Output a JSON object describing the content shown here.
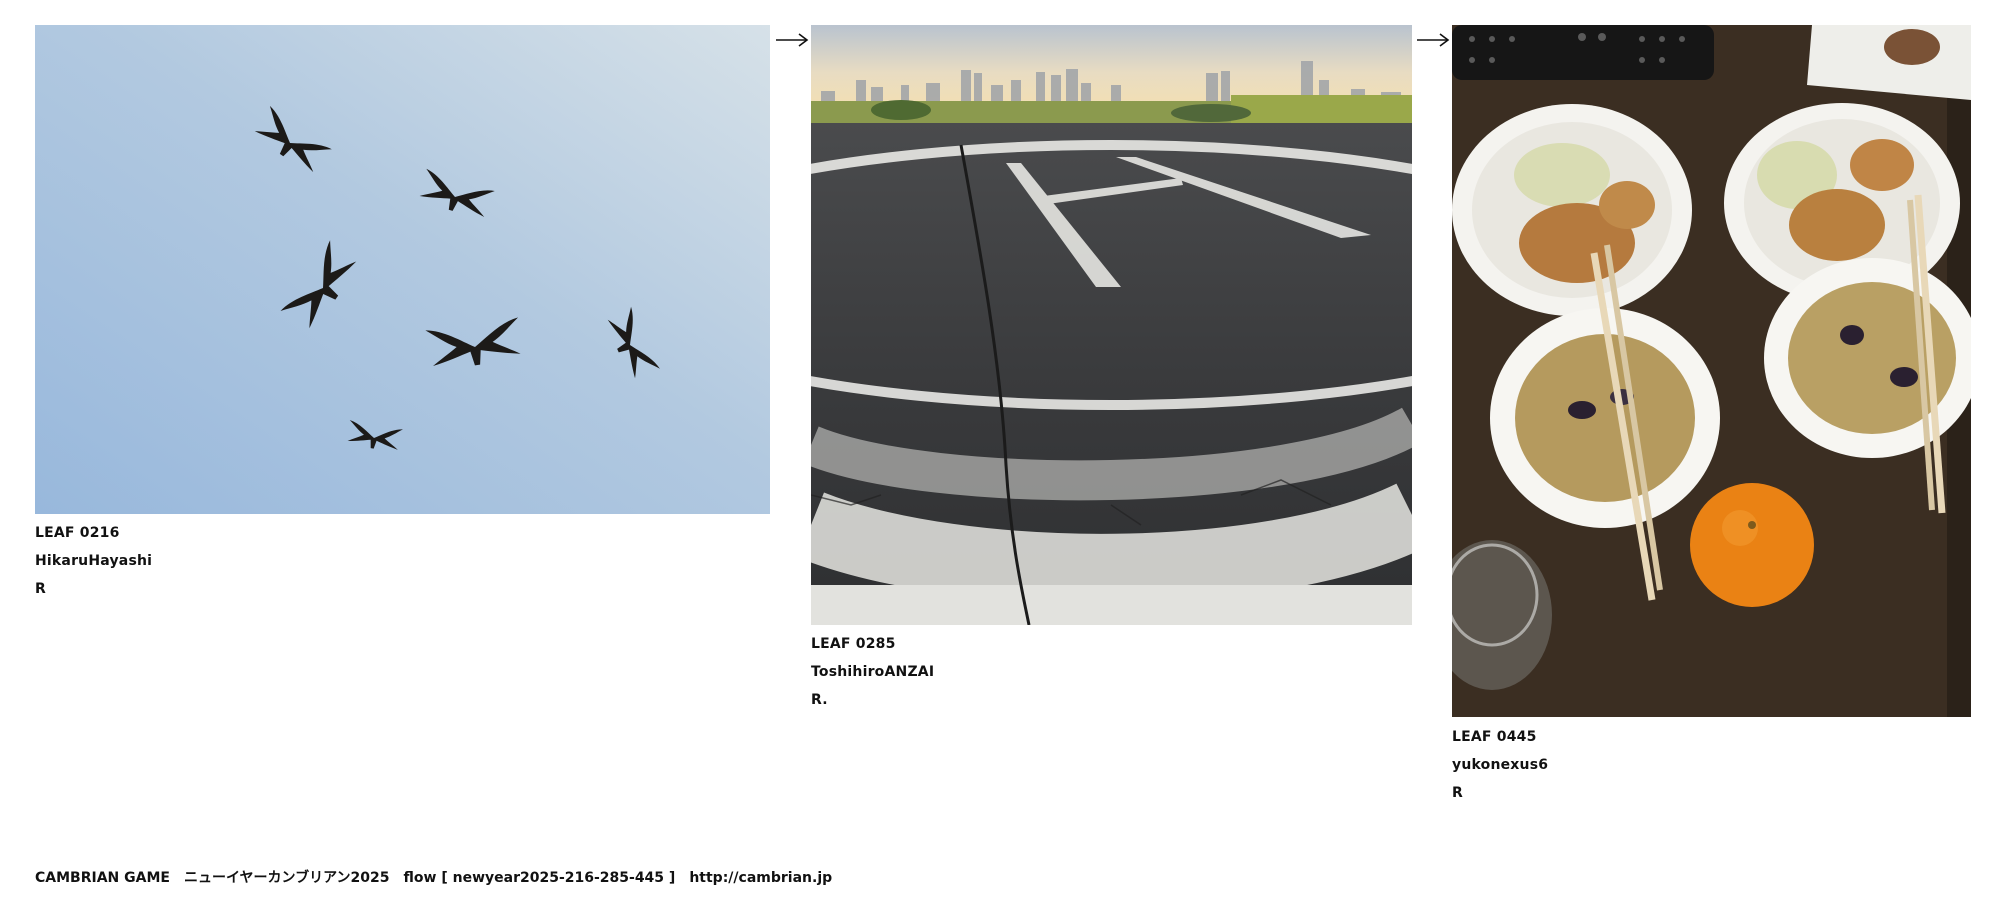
{
  "leaves": [
    {
      "id": "LEAF 0216",
      "author": "HikaruHayashi",
      "mark": "R"
    },
    {
      "id": "LEAF 0285",
      "author": "ToshihiroANZAI",
      "mark": "R."
    },
    {
      "id": "LEAF 0445",
      "author": "yukonexus6",
      "mark": "R"
    }
  ],
  "footer": {
    "brand": "CAMBRIAN GAME",
    "title": "ニューイヤーカンブリアン2025",
    "flow": "flow [ newyear2025-216-285-445 ]",
    "url": "http://cambrian.jp"
  }
}
